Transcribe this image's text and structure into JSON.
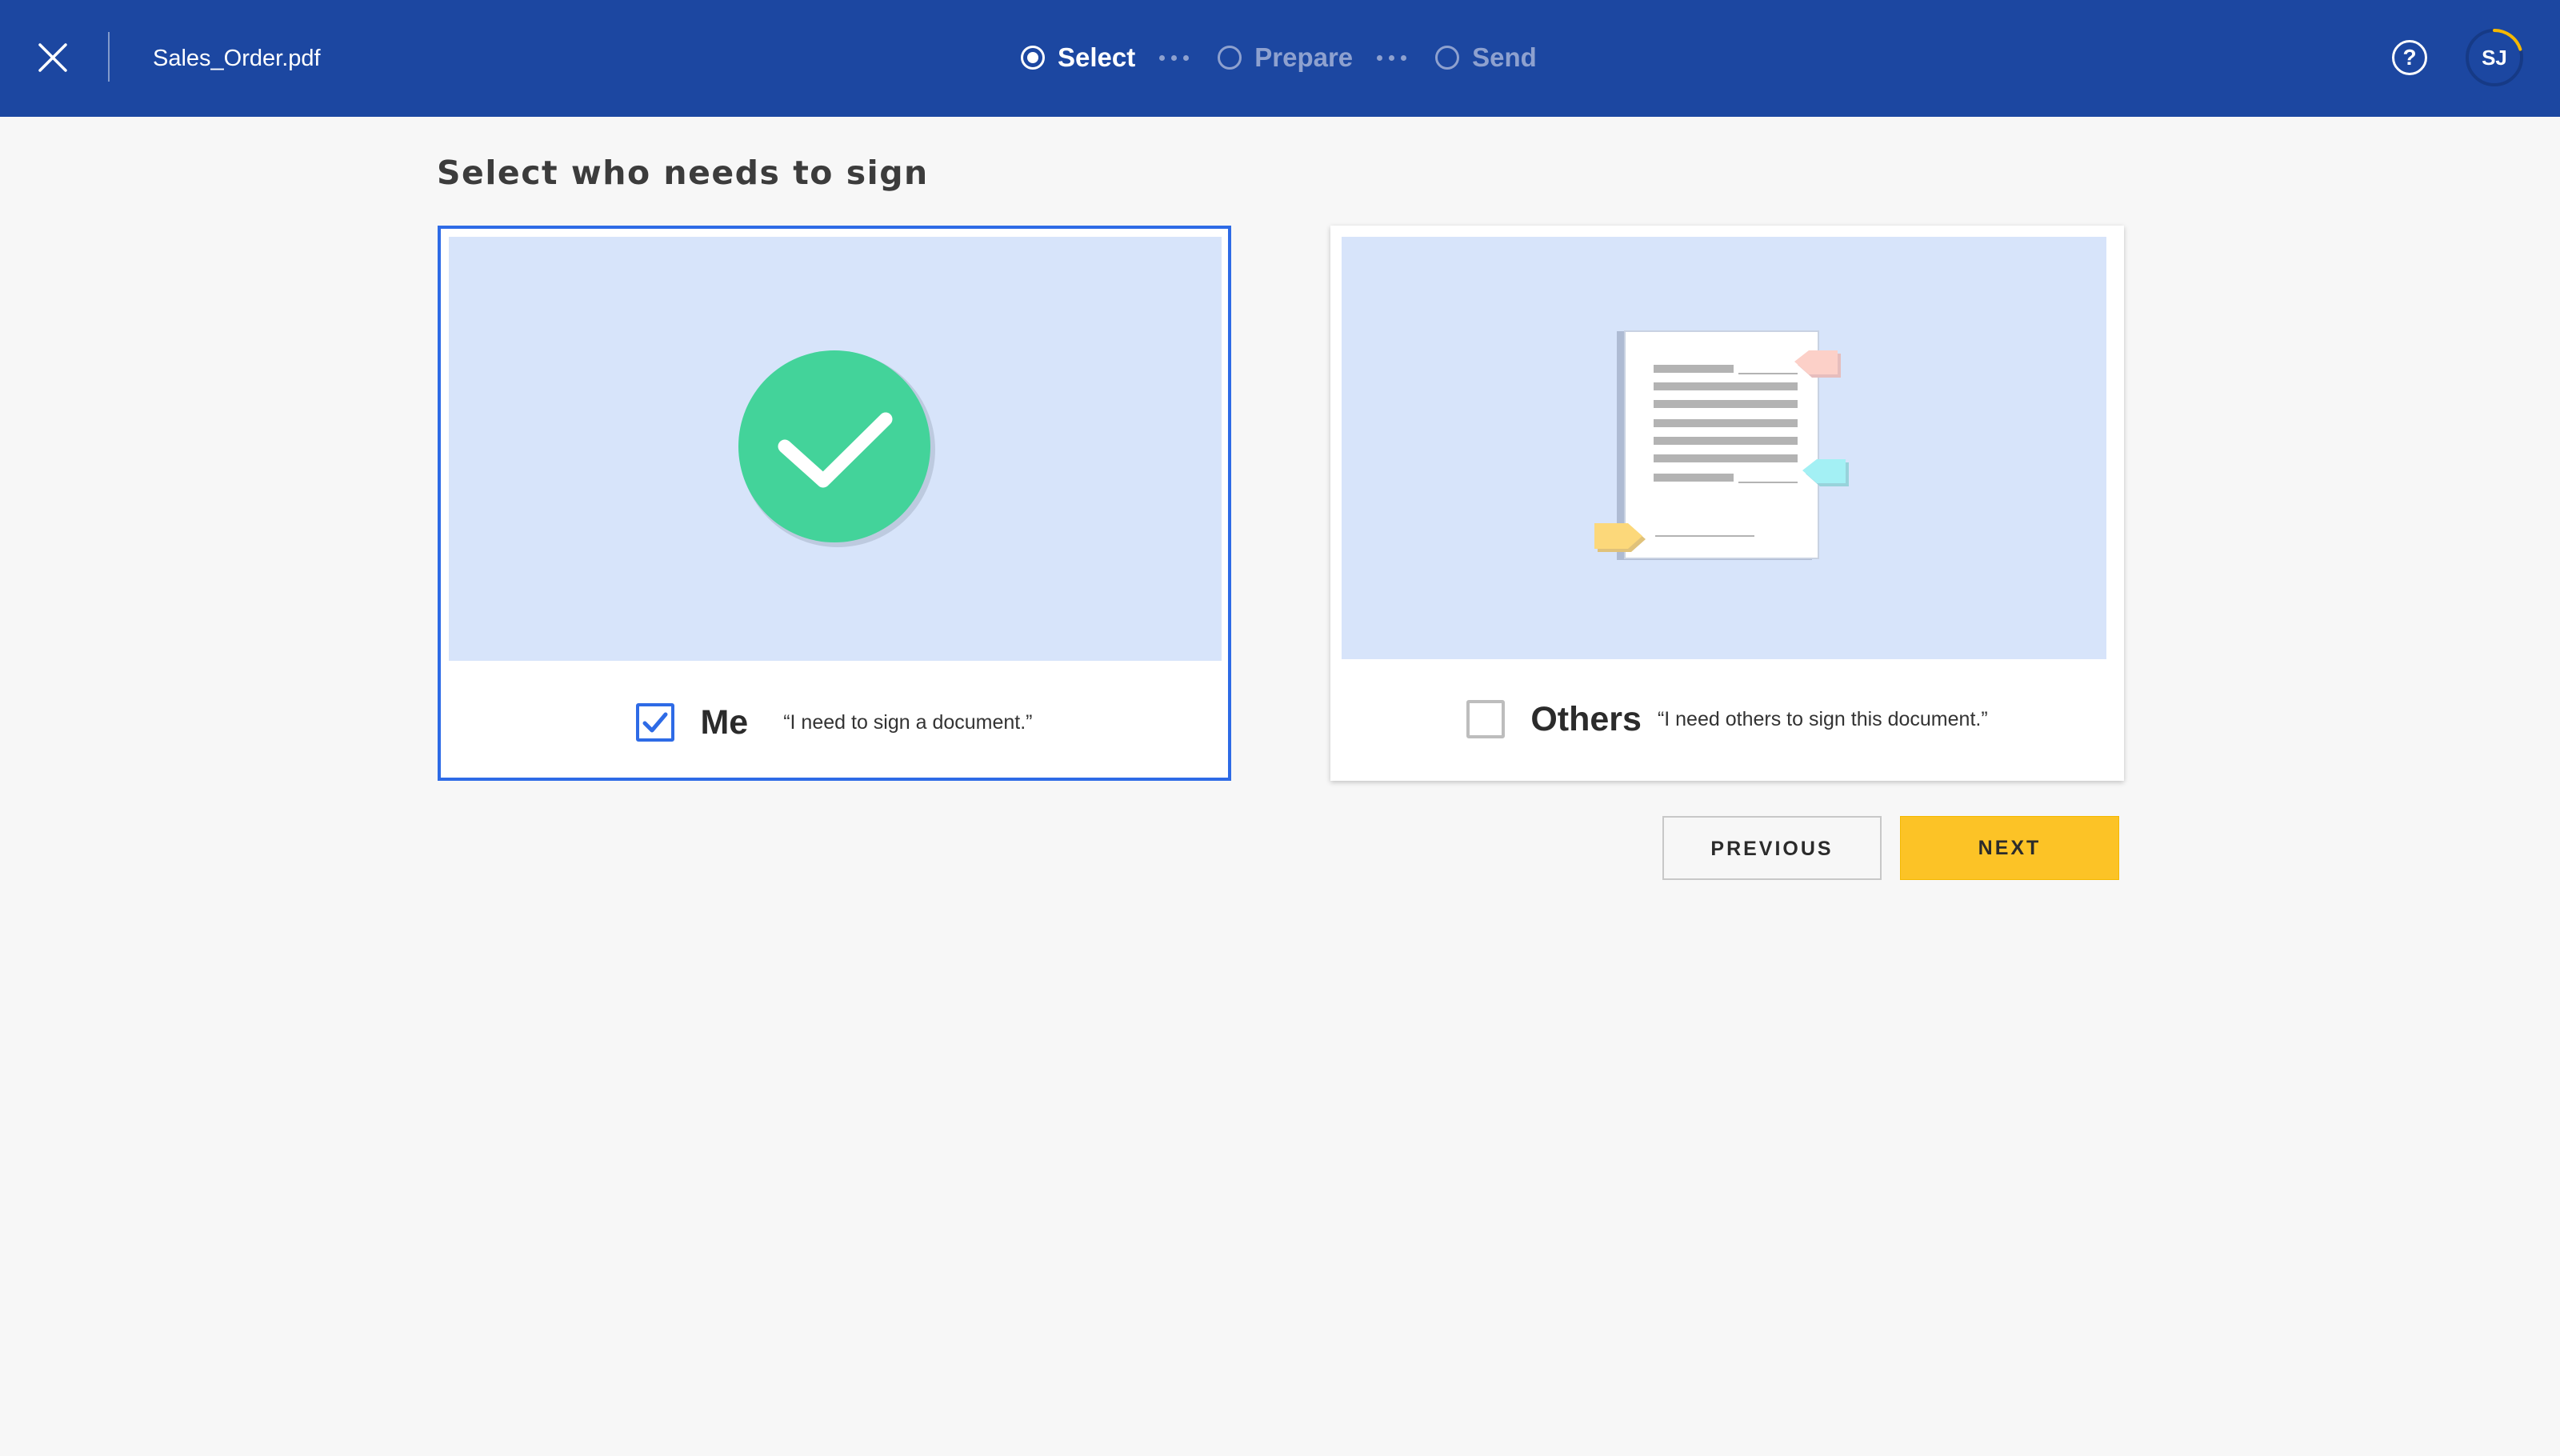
{
  "header": {
    "filename": "Sales_Order.pdf",
    "steps": [
      {
        "label": "Select",
        "state": "active"
      },
      {
        "label": "Prepare",
        "state": "inactive"
      },
      {
        "label": "Send",
        "state": "inactive"
      }
    ],
    "help_symbol": "?",
    "avatar_initials": "SJ",
    "avatar_progress_fraction": 0.2
  },
  "main": {
    "title": "Select who needs to sign",
    "options": [
      {
        "label": "Me",
        "quote": "“I need to sign a document.”",
        "checked": true,
        "illustration": "checkmark-circle"
      },
      {
        "label": "Others",
        "quote": "“I need others to sign this document.”",
        "checked": false,
        "illustration": "document-with-signature-tags"
      }
    ]
  },
  "actions": {
    "previous_label": "PREVIOUS",
    "next_label": "NEXT"
  },
  "colors": {
    "header_bg": "#1c47a1",
    "page_bg": "#f7f7f7",
    "selected_border": "#2e6be6",
    "illustration_bg": "#d7e4fa",
    "check_green": "#43d39a",
    "next_button": "#fcc326",
    "avatar_ring": "#f5b800"
  },
  "icons": {
    "close": "close-icon",
    "help": "help-icon",
    "checkbox_check": "checkmark-icon"
  }
}
